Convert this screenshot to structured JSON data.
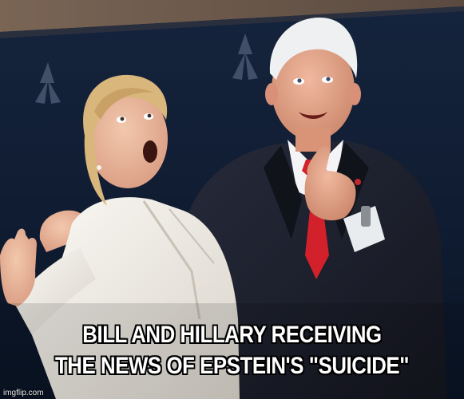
{
  "caption": {
    "line1": "BILL AND HILLARY RECEIVING",
    "line2": "THE NEWS OF EPSTEIN'S \"SUICIDE\""
  },
  "watermark": "imgflip.com",
  "colors": {
    "background": "#0d1a2e",
    "stage_banner": "#6e5a4c",
    "white_suit": "#f3f0ea",
    "dark_suit": "#1b1e2b",
    "red_tie": "#d3212b",
    "caption_text": "#ffffff",
    "caption_outline": "#000000"
  }
}
